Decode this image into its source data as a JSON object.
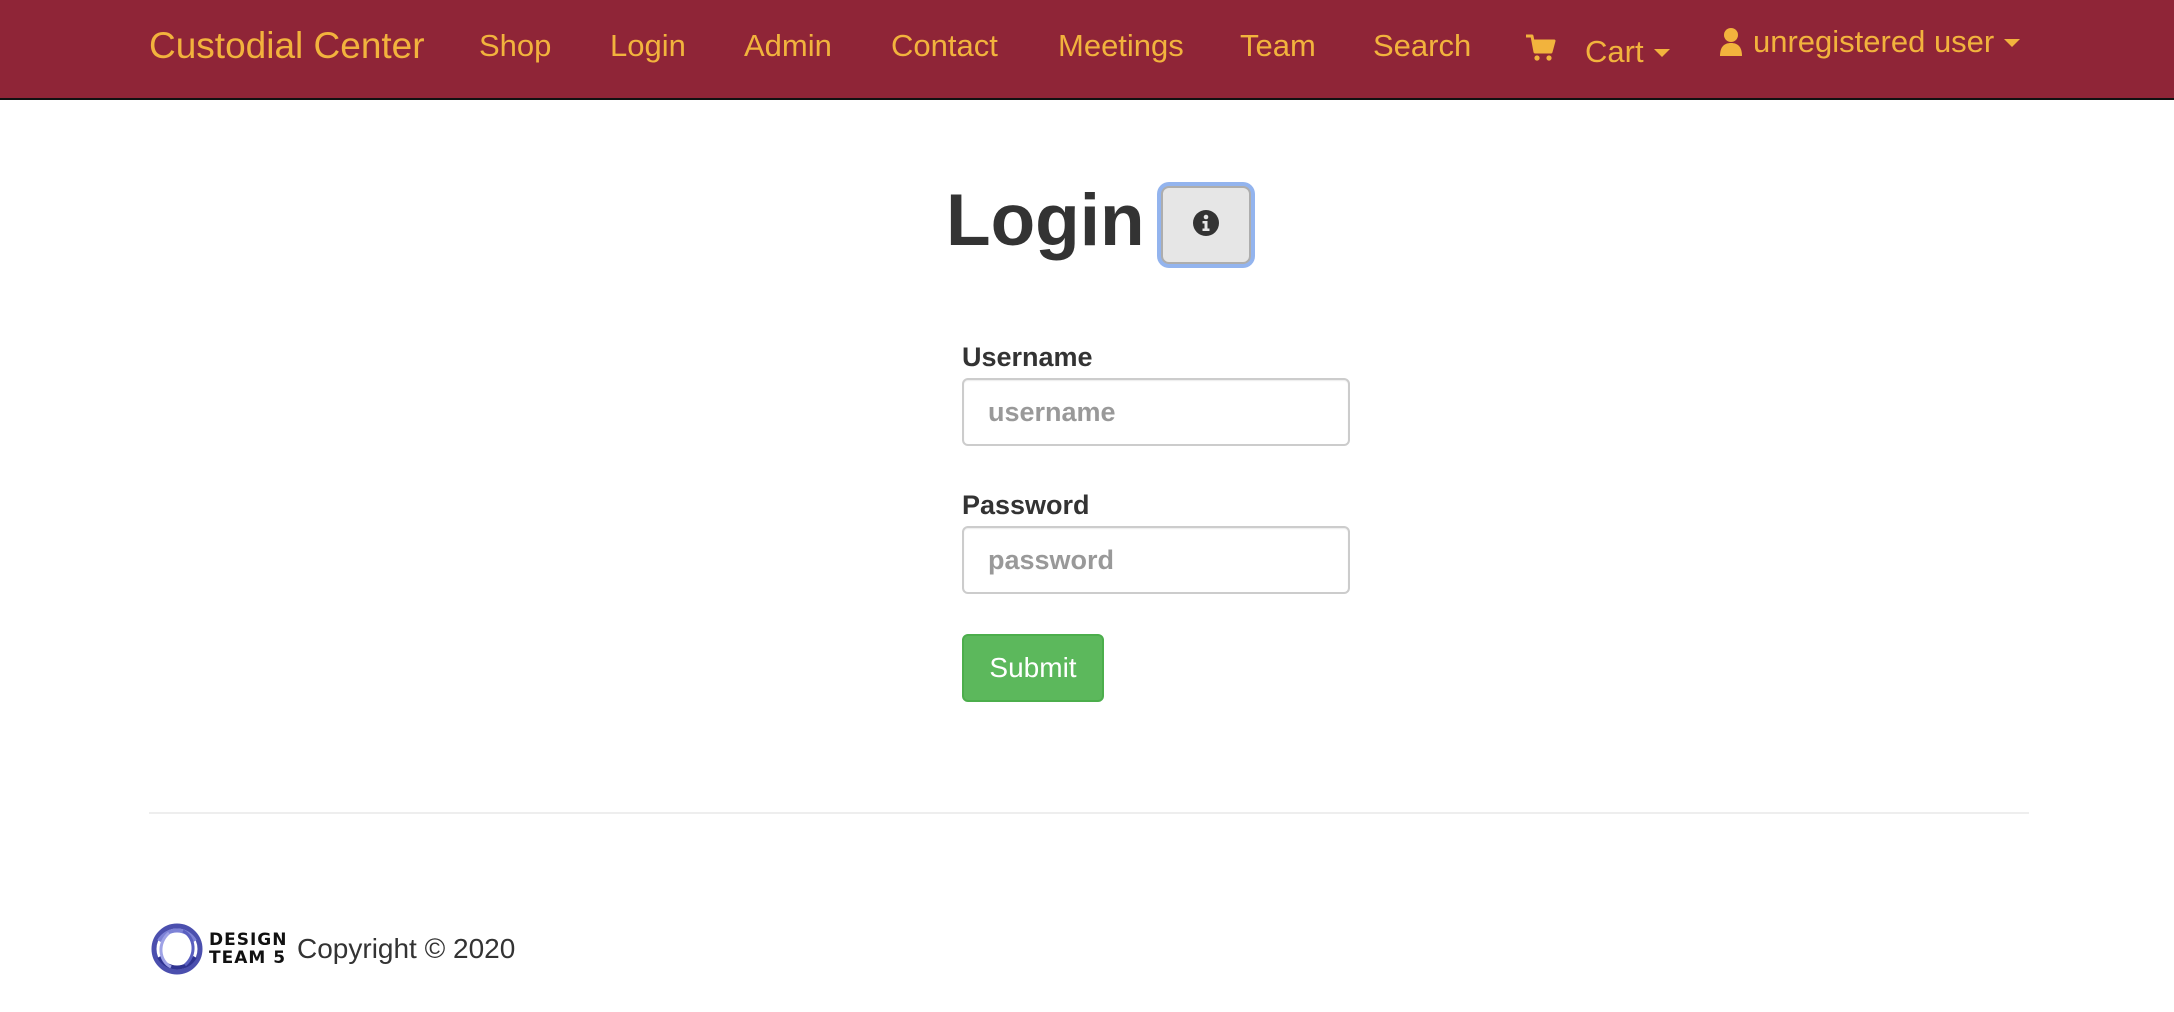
{
  "navbar": {
    "brand": "Custodial Center",
    "links": [
      "Shop",
      "Login",
      "Admin",
      "Contact",
      "Meetings",
      "Team",
      "Search"
    ],
    "cart_label": "Cart",
    "user_label": "unregistered user",
    "text_color": "#f2b33d",
    "background": "#8f2537"
  },
  "page": {
    "title": "Login",
    "info_icon": "info-circle-icon"
  },
  "form": {
    "username": {
      "label": "Username",
      "placeholder": "username",
      "value": ""
    },
    "password": {
      "label": "Password",
      "placeholder": "password",
      "value": ""
    },
    "submit_label": "Submit",
    "submit_color": "#5cb85c"
  },
  "footer": {
    "logo_line1": "DESIGN",
    "logo_line2": "TEAM 5",
    "copyright": "Copyright © 2020"
  }
}
